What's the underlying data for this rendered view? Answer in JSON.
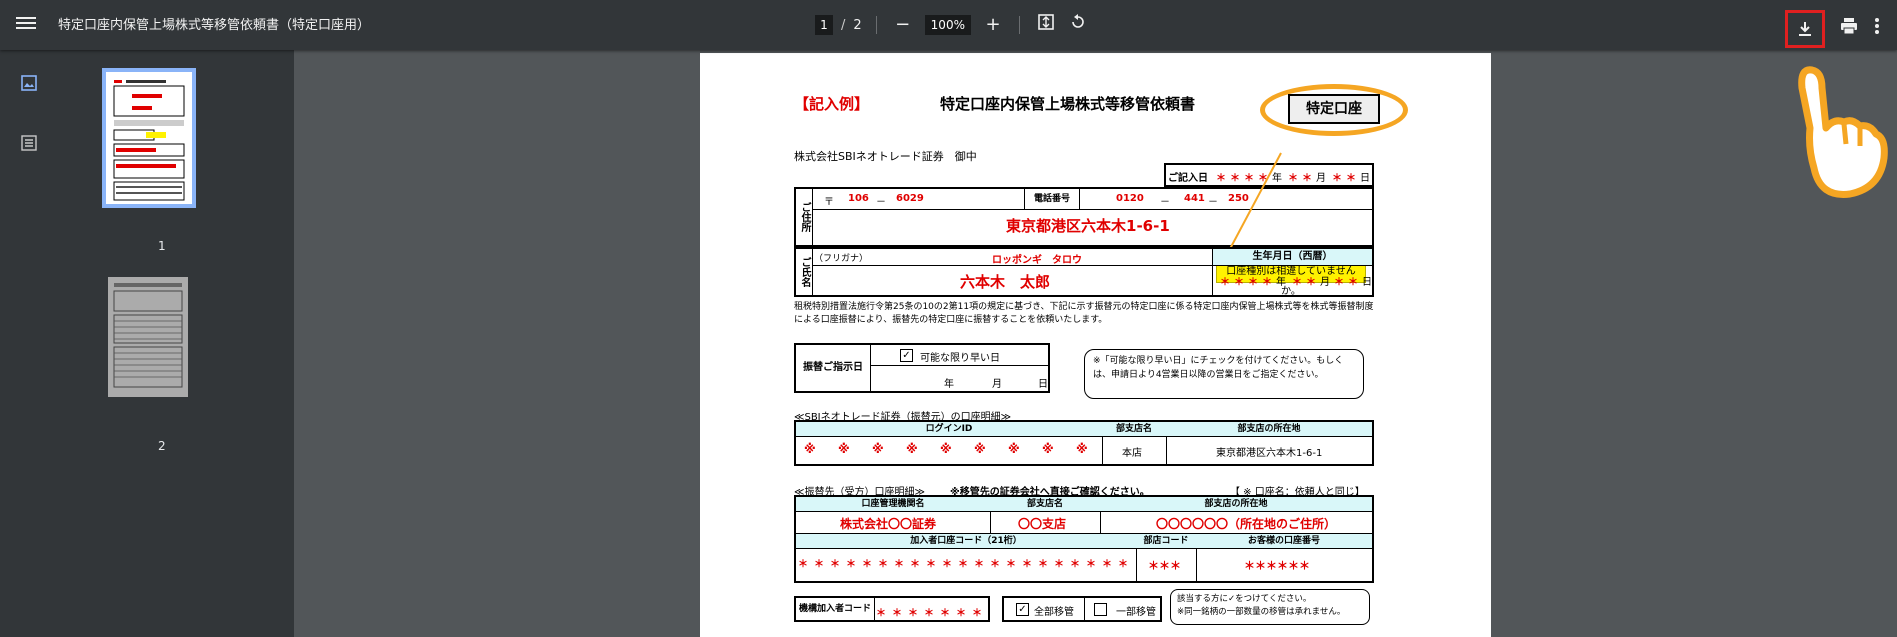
{
  "toolbar": {
    "title": "特定口座内保管上場株式等移管依頼書（特定口座用）",
    "current_page": "1",
    "page_sep": "/",
    "total_pages": "2",
    "zoom": "100%",
    "zoom_out": "−",
    "zoom_in": "+"
  },
  "sidebar": {
    "thumbnails": [
      {
        "label": "1"
      },
      {
        "label": "2"
      }
    ]
  },
  "doc": {
    "example_tag": "【記入例】",
    "title": "特定口座内保管上場株式等移管依頼書",
    "account_type_badge": "特定口座",
    "addressee": "株式会社SBIネオトレード証券　御中",
    "entry_date_label": "ご記入日",
    "year": "年",
    "month": "月",
    "day": "日",
    "star": "＊",
    "address_label": "ご住所",
    "postal_mark": "〒",
    "postal_1": "106",
    "dash": "－",
    "postal_2": "6029",
    "phone_label": "電話番号",
    "phone_1": "0120",
    "phone_2": "441",
    "phone_3": "250",
    "address_value": "東京都港区六本木1-6-1",
    "tooltip": "口座種別は相違していませんか。",
    "name_label": "ご氏名",
    "furigana_label": "（フリガナ）",
    "furigana_value": "ロッポンギ　タロウ",
    "birth_label": "生年月日（西暦）",
    "name_value": "六本木　太郎",
    "notice": "租税特別措置法施行令第25条の10の2第11項の規定に基づき、下記に示す振替元の特定口座に係る特定口座内保管上場株式等を株式等振替制度による口座振替により、振替先の特定口座に振替することを依頼いたします。",
    "transfer_date_label": "振替ご指示日",
    "earliest_label": "可能な限り早い日",
    "transfer_note": "※「可能な限り早い日」にチェックを付けてください。もしくは、申請日より4営業日以降の営業日をご指定ください。",
    "source_section": "≪SBIネオトレード証券（振替元）の口座明細≫",
    "login_id_label": "ログインID",
    "branch_label": "部支店名",
    "branch_address_label": "部支店の所在地",
    "kome": "※",
    "branch_value": "本店",
    "branch_address_value": "東京都港区六本木1-6-1",
    "dest_section": "≪振替先（受方）口座明細≫",
    "dest_warning": "※移管先の証券会社へ直接ご確認ください。",
    "dest_note": "【 ※ 口座名：依頼人と同じ】",
    "firm_name_label": "口座管理機関名",
    "firm_name_value": "株式会社〇〇証券",
    "dest_branch_value": "〇〇支店",
    "dest_branch_address_value": "〇〇〇〇〇〇（所在地のご住所）",
    "subscriber_code_label": "加入者口座コード（21桁）",
    "branch_code_label": "部店コード",
    "customer_acct_label": "お客様の口座番号",
    "three_stars": "＊＊＊",
    "six_stars": "＊＊＊＊＊＊",
    "institution_code_label": "機構加入者コード",
    "all_transfer_label": "全部移管",
    "partial_transfer_label": "一部移管",
    "transfer_note_2a": "該当する方に✓をつけてください。",
    "transfer_note_2b": "※同一銘柄の一部数量の移管は承れません。"
  },
  "colors": {
    "toolbar_bg": "#323639",
    "viewer_bg": "#525659",
    "highlight_red": "#e02020",
    "orange_circle": "#f5a623",
    "doc_red": "#e00000",
    "cell_cyan": "#d9f7f9",
    "tooltip_yellow": "#fff200"
  },
  "icons": [
    "menu-icon",
    "fit-page-icon",
    "rotate-icon",
    "download-icon",
    "print-icon",
    "more-vert-icon",
    "thumbnail-view-icon",
    "outline-view-icon",
    "pointing-hand-icon"
  ]
}
